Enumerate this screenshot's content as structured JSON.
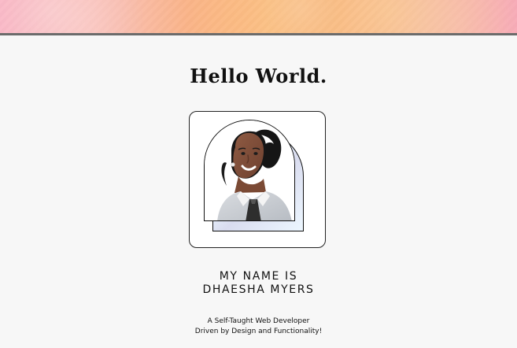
{
  "hero": {
    "colors": {
      "banner_pink": "#f7a6b8",
      "banner_peach": "#f7b18e",
      "banner_gold": "#f8c38b",
      "divider": "#6b6b6b"
    }
  },
  "intro": {
    "greeting": "Hello World."
  },
  "profile": {
    "image_label": "profile-portrait",
    "name_line_1": "MY NAME IS",
    "name_line_2": "DHAESHA MYERS",
    "tagline_line_1": "A Self-Taught Web Developer",
    "tagline_line_2": "Driven by Design and Functionality!"
  }
}
